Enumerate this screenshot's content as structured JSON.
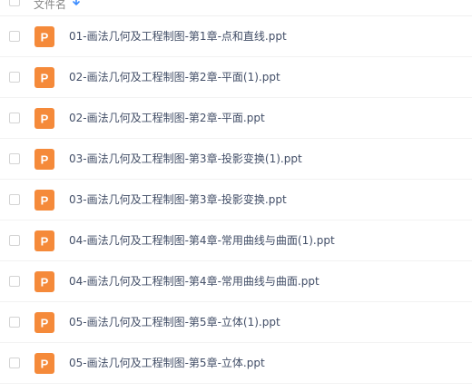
{
  "header": {
    "name_label": "文件名",
    "sort_icon": "sort-arrow-icon",
    "accent_color": "#3b8cff"
  },
  "file_icon": {
    "name": "ppt-file-icon",
    "letter": "P",
    "color": "#f58a3a"
  },
  "files": [
    {
      "name": "01-画法几何及工程制图-第1章-点和直线.ppt"
    },
    {
      "name": "02-画法几何及工程制图-第2章-平面(1).ppt"
    },
    {
      "name": "02-画法几何及工程制图-第2章-平面.ppt"
    },
    {
      "name": "03-画法几何及工程制图-第3章-投影变换(1).ppt"
    },
    {
      "name": "03-画法几何及工程制图-第3章-投影变换.ppt"
    },
    {
      "name": "04-画法几何及工程制图-第4章-常用曲线与曲面(1).ppt"
    },
    {
      "name": "04-画法几何及工程制图-第4章-常用曲线与曲面.ppt"
    },
    {
      "name": "05-画法几何及工程制图-第5章-立体(1).ppt"
    },
    {
      "name": "05-画法几何及工程制图-第5章-立体.ppt"
    }
  ]
}
